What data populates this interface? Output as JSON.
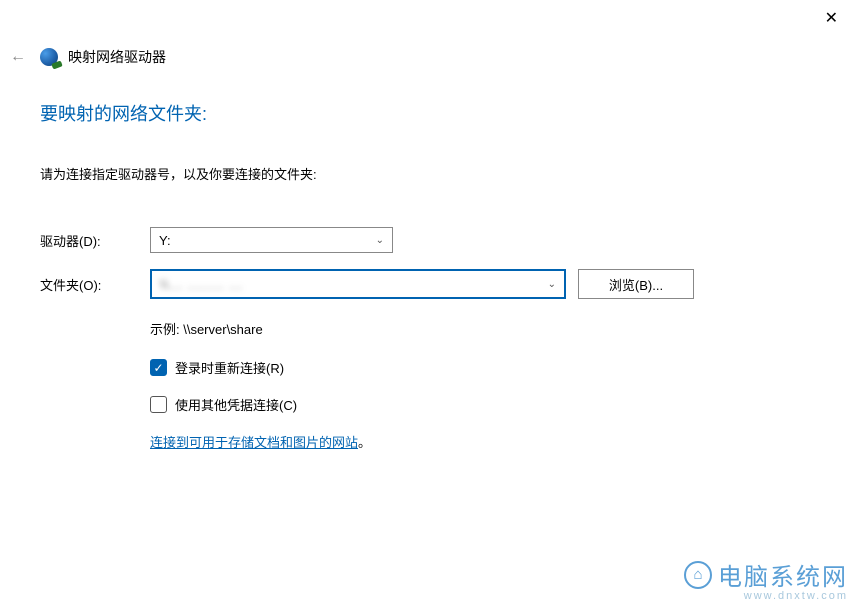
{
  "window": {
    "title": "映射网络驱动器"
  },
  "heading": "要映射的网络文件夹:",
  "description": "请为连接指定驱动器号，以及你要连接的文件夹:",
  "form": {
    "drive_label": "驱动器(D):",
    "drive_value": "Y:",
    "folder_label": "文件夹(O):",
    "folder_value": "\\\\...  ........  ...",
    "browse_label": "浏览(B)...",
    "example": "示例: \\\\server\\share",
    "reconnect_label": "登录时重新连接(R)",
    "reconnect_checked": true,
    "credentials_label": "使用其他凭据连接(C)",
    "credentials_checked": false,
    "link_text": "连接到可用于存储文档和图片的网站",
    "link_period": "。"
  },
  "watermark": {
    "text": "电脑系统网",
    "url": "www.dnxtw.com"
  }
}
